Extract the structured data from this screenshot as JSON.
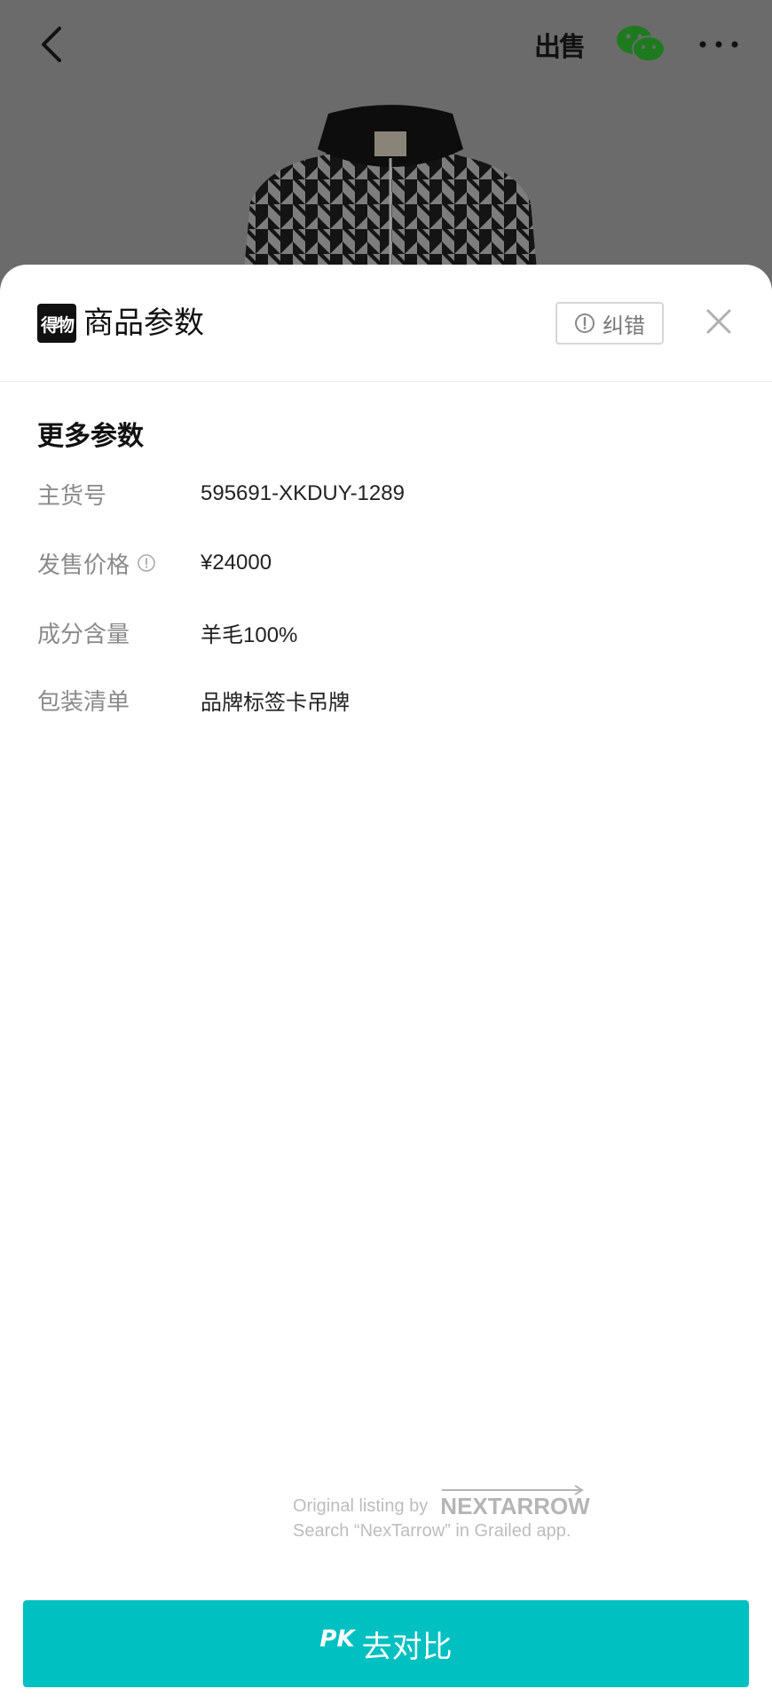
{
  "topbar": {
    "sell_label": "出售",
    "icons": {
      "back": "chevron-left-icon",
      "sell": "sell-icon",
      "share": "wechat-icon",
      "more": "more-icon"
    }
  },
  "sheet": {
    "brand_logo_text": "得物",
    "title": "商品参数",
    "report_label": "纠错",
    "section_title": "更多参数",
    "params": [
      {
        "label": "主货号",
        "value": "595691-XKDUY-1289",
        "has_info": false
      },
      {
        "label": "发售价格",
        "value": "¥24000",
        "has_info": true
      },
      {
        "label": "成分含量",
        "value": "羊毛100%",
        "has_info": false
      },
      {
        "label": "包装清单",
        "value": "品牌标签卡吊牌",
        "has_info": false
      }
    ],
    "watermark": {
      "line1_prefix": "Original listing by",
      "logo": "NEXTARROW",
      "line2": "Search “NexTarrow” in Grailed app."
    },
    "pk_button": {
      "prefix": "PK",
      "label": "去对比"
    }
  },
  "colors": {
    "accent": "#00c0c1",
    "backdrop": "#6b6b6b",
    "wechat": "#1aad19"
  }
}
